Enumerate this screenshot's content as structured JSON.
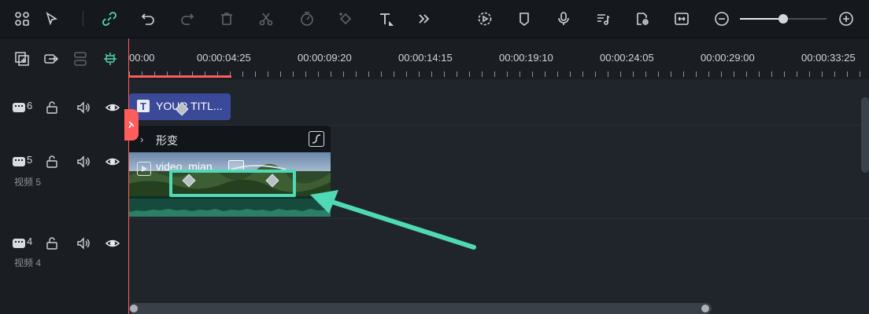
{
  "toolbar": {
    "left_icons": [
      "layout-icon",
      "select-tool-icon",
      "link-icon",
      "undo-icon",
      "redo-icon",
      "delete-icon",
      "cut-icon",
      "speed-icon",
      "keyframe-icon",
      "text-icon",
      "more-icon"
    ],
    "right_icons": [
      "auto-ripple-icon",
      "marker-icon",
      "microphone-icon",
      "audio-mix-icon",
      "preview-render-icon",
      "fit-timeline-icon",
      "zoom-out-icon",
      "zoom-in-icon"
    ],
    "zoom_level": 0.5,
    "accent_color": "#4fd9b5"
  },
  "ruler": {
    "ticks": [
      "00:00",
      "00:00:04:25",
      "00:00:09:20",
      "00:00:14:15",
      "00:00:19:10",
      "00:00:24:05",
      "00:00:29:00",
      "00:00:33:25"
    ]
  },
  "tracks": [
    {
      "number": "6",
      "name": ""
    },
    {
      "number": "5",
      "name": "视频 5"
    },
    {
      "number": "4",
      "name": "视频 4"
    }
  ],
  "title_clip": {
    "label": "YOUR TITL...",
    "icon": "T"
  },
  "popup": {
    "label": "形变"
  },
  "video_clip": {
    "label": "video_mian"
  },
  "colors": {
    "playhead": "#ff5c5c",
    "title_clip": "#3a4a98",
    "audio_wave": "#164a3c",
    "highlight": "#4fd9b5"
  }
}
